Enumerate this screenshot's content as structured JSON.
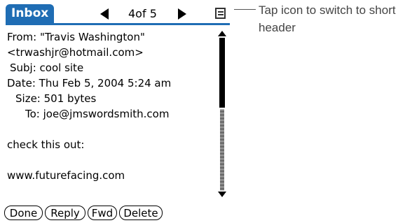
{
  "titlebar": {
    "app_label": "Inbox",
    "message_position": "4of 5"
  },
  "header_fields": {
    "from": "From: \"Travis Washington\"",
    "from_email": "<trwashjr@hotmail.com>",
    "subject": "Subj: cool site",
    "date": "Date: Thu Feb 5, 2004 5:24 am",
    "size": "Size: 501 bytes",
    "to": "To: joe@jmswordsmith.com"
  },
  "message_body": {
    "line1": "check this out:",
    "line2": "www.futurefacing.com"
  },
  "buttons": {
    "done": "Done",
    "reply": "Reply",
    "fwd": "Fwd",
    "delete": "Delete"
  },
  "callout": {
    "text": "Tap icon to switch to short header"
  },
  "icons": {
    "prev": "left-arrow-icon",
    "next": "right-arrow-icon",
    "header_toggle": "header-toggle-icon",
    "scroll_up": "scroll-up-icon",
    "scroll_down": "scroll-down-icon"
  },
  "colors": {
    "accent": "#1f6db4"
  }
}
